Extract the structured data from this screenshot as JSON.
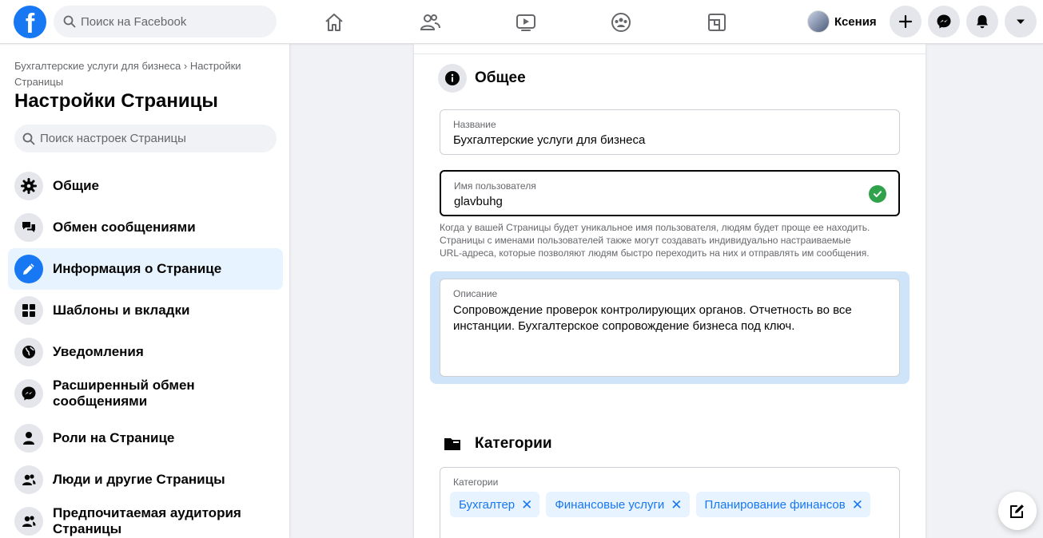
{
  "topbar": {
    "logo_letter": "f",
    "search_placeholder": "Поиск на Facebook",
    "nav_icons": [
      "home-icon",
      "friends-icon",
      "watch-icon",
      "groups-icon",
      "gaming-icon"
    ],
    "profile_name": "Ксения",
    "action_icons": [
      "plus-icon",
      "messenger-icon",
      "bell-icon",
      "caret-down-icon"
    ]
  },
  "sidebar": {
    "breadcrumb": "Бухгалтерские услуги для бизнеса › Настройки Страницы",
    "title": "Настройки Страницы",
    "search_placeholder": "Поиск настроек Страницы",
    "items": [
      {
        "label": "Общие",
        "icon": "gear-icon",
        "active": false
      },
      {
        "label": "Обмен сообщениями",
        "icon": "chat-icon",
        "active": false
      },
      {
        "label": "Информация о Странице",
        "icon": "pencil-icon",
        "active": true
      },
      {
        "label": "Шаблоны и вкладки",
        "icon": "grid-icon",
        "active": false
      },
      {
        "label": "Уведомления",
        "icon": "globe-icon",
        "active": false
      },
      {
        "label": "Расширенный обмен сообщениями",
        "icon": "messenger-icon",
        "active": false
      },
      {
        "label": "Роли на Странице",
        "icon": "person-icon",
        "active": false
      },
      {
        "label": "Люди и другие Страницы",
        "icon": "people-icon",
        "active": false
      },
      {
        "label": "Предпочитаемая аудитория Страницы",
        "icon": "people-icon",
        "active": false
      }
    ]
  },
  "main": {
    "general": {
      "title": "Общее",
      "name_label": "Название",
      "name_value": "Бухгалтерские услуги для бизнеса",
      "username_label": "Имя пользователя",
      "username_value": "glavbuhg",
      "username_hint": "Когда у вашей Страницы будет уникальное имя пользователя, людям будет проще ее находить. Страницы с именами пользователей также могут создавать индивидуально настраиваемые URL-адреса, которые позволяют людям быстро переходить на них и отправлять им сообщения.",
      "description_label": "Описание",
      "description_value": "Сопровождение проверок контролирующих органов. Отчетность во все инстанции. Бухгалтерское сопровождение бизнеса под ключ."
    },
    "categories": {
      "title": "Категории",
      "field_label": "Категории",
      "tags": [
        "Бухгалтер",
        "Финансовые услуги",
        "Планирование финансов"
      ]
    }
  },
  "colors": {
    "accent": "#1877f2",
    "active_bg": "#e7f3ff",
    "success": "#31a24c"
  }
}
